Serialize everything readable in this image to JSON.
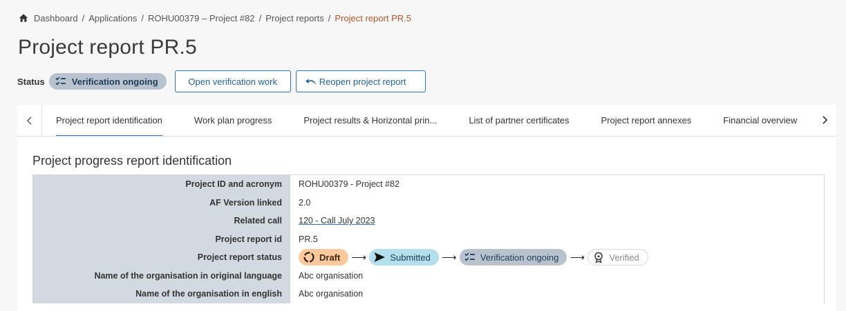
{
  "breadcrumb": {
    "items": [
      "Dashboard",
      "Applications",
      "ROHU00379 – Project #82",
      "Project reports",
      "Project report PR.5"
    ],
    "separator": "/"
  },
  "page": {
    "title": "Project report PR.5"
  },
  "status": {
    "label": "Status",
    "value": "Verification ongoing",
    "open_button": "Open verification work",
    "reopen_button": "Reopen project report"
  },
  "tabs": [
    "Project report identification",
    "Work plan progress",
    "Project results & Horizontal prin...",
    "List of partner certificates",
    "Project report annexes",
    "Financial overview"
  ],
  "active_tab": 0,
  "section": {
    "title": "Project progress report identification",
    "rows": [
      {
        "key": "Project ID and acronym",
        "value": "ROHU00379 - Project #82"
      },
      {
        "key": "AF Version linked",
        "value": "2.0"
      },
      {
        "key": "Related call",
        "value": "120 - Call July 2023"
      },
      {
        "key": "Project report id",
        "value": "PR.5"
      },
      {
        "key": "Project report status",
        "value": ""
      },
      {
        "key": "Name of the organisation in original language",
        "value": "Abc organisation"
      },
      {
        "key": "Name of the organisation in english",
        "value": "Abc organisation"
      }
    ],
    "status_flow": [
      "Draft",
      "Submitted",
      "Verification ongoing",
      "Verified"
    ]
  },
  "colors": {
    "accent": "#2a73b8",
    "breadcrumb_current": "#b5562a",
    "draft": "#fdc99c",
    "submitted": "#b3e0ec",
    "verification": "#b9c3cf",
    "table_key_bg": "#d2d9e1"
  },
  "icons": {
    "home": "home-icon",
    "verification": "checklist-icon",
    "reopen": "undo-arrow-icon",
    "draft": "progress-circle-icon",
    "submitted": "send-icon",
    "verified": "award-icon",
    "tab_prev": "chevron-left-icon",
    "tab_next": "chevron-right-icon"
  }
}
